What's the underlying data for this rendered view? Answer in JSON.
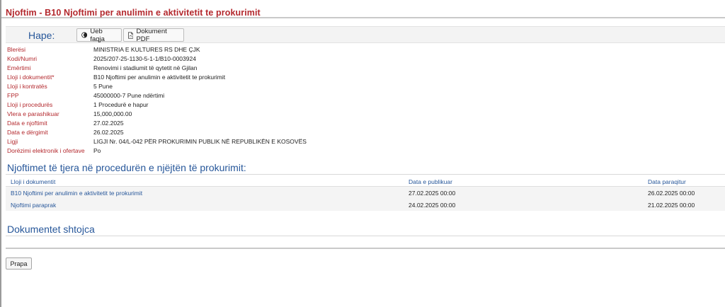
{
  "page": {
    "title": "Njoftim - B10 Njoftimi per anulimin e aktivitetit te prokurimit"
  },
  "actions": {
    "label": "Hape:",
    "web_button": "Ueb faqja",
    "pdf_button": "Dokument PDF"
  },
  "details": [
    {
      "key": "Blerësi",
      "value": "MINISTRIA E KULTURES RS DHE ÇJK"
    },
    {
      "key": "Kodi/Numri",
      "value": "2025/207-25-1130-5-1-1/B10-0003924"
    },
    {
      "key": "Emërtimi",
      "value": "Renovimi i stadiumit të qytetit në Gjilan"
    },
    {
      "key": "Lloji i dokumentit*",
      "value": "B10 Njoftimi per anulimin e aktivitetit te prokurimit"
    },
    {
      "key": "Lloji i kontratës",
      "value": "5 Pune"
    },
    {
      "key": "FPP",
      "value": "45000000-7 Pune ndërtimi"
    },
    {
      "key": "Lloji i procedurës",
      "value": "1 Procedurë e hapur"
    },
    {
      "key": "Vlera e parashikuar",
      "value": "15,000,000.00"
    },
    {
      "key": "Data e njoftimit",
      "value": "27.02.2025"
    },
    {
      "key": "Data e dërgimit",
      "value": "26.02.2025"
    },
    {
      "key": "Ligji",
      "value": "LIGJI Nr. 04/L-042 PËR PROKURIMIN PUBLIK NË REPUBLIKËN E KOSOVËS"
    },
    {
      "key": "Dorëzimi elektronik i ofertave",
      "value": "Po"
    }
  ],
  "other_notices": {
    "heading": "Njoftimet të tjera në procedurën e njëjtën të prokurimit:",
    "columns": [
      "Lloji i dokumentit",
      "Data e publikuar",
      "Data paraqitur"
    ],
    "rows": [
      [
        "B10 Njoftimi per anulimin e aktivitetit te prokurimit",
        "27.02.2025 00:00",
        "26.02.2025 00:00"
      ],
      [
        "Njoftimi paraprak",
        "24.02.2025 00:00",
        "21.02.2025 00:00"
      ]
    ]
  },
  "attachments": {
    "heading": "Dokumentet shtojca"
  },
  "footer": {
    "back_button": "Prapa"
  }
}
